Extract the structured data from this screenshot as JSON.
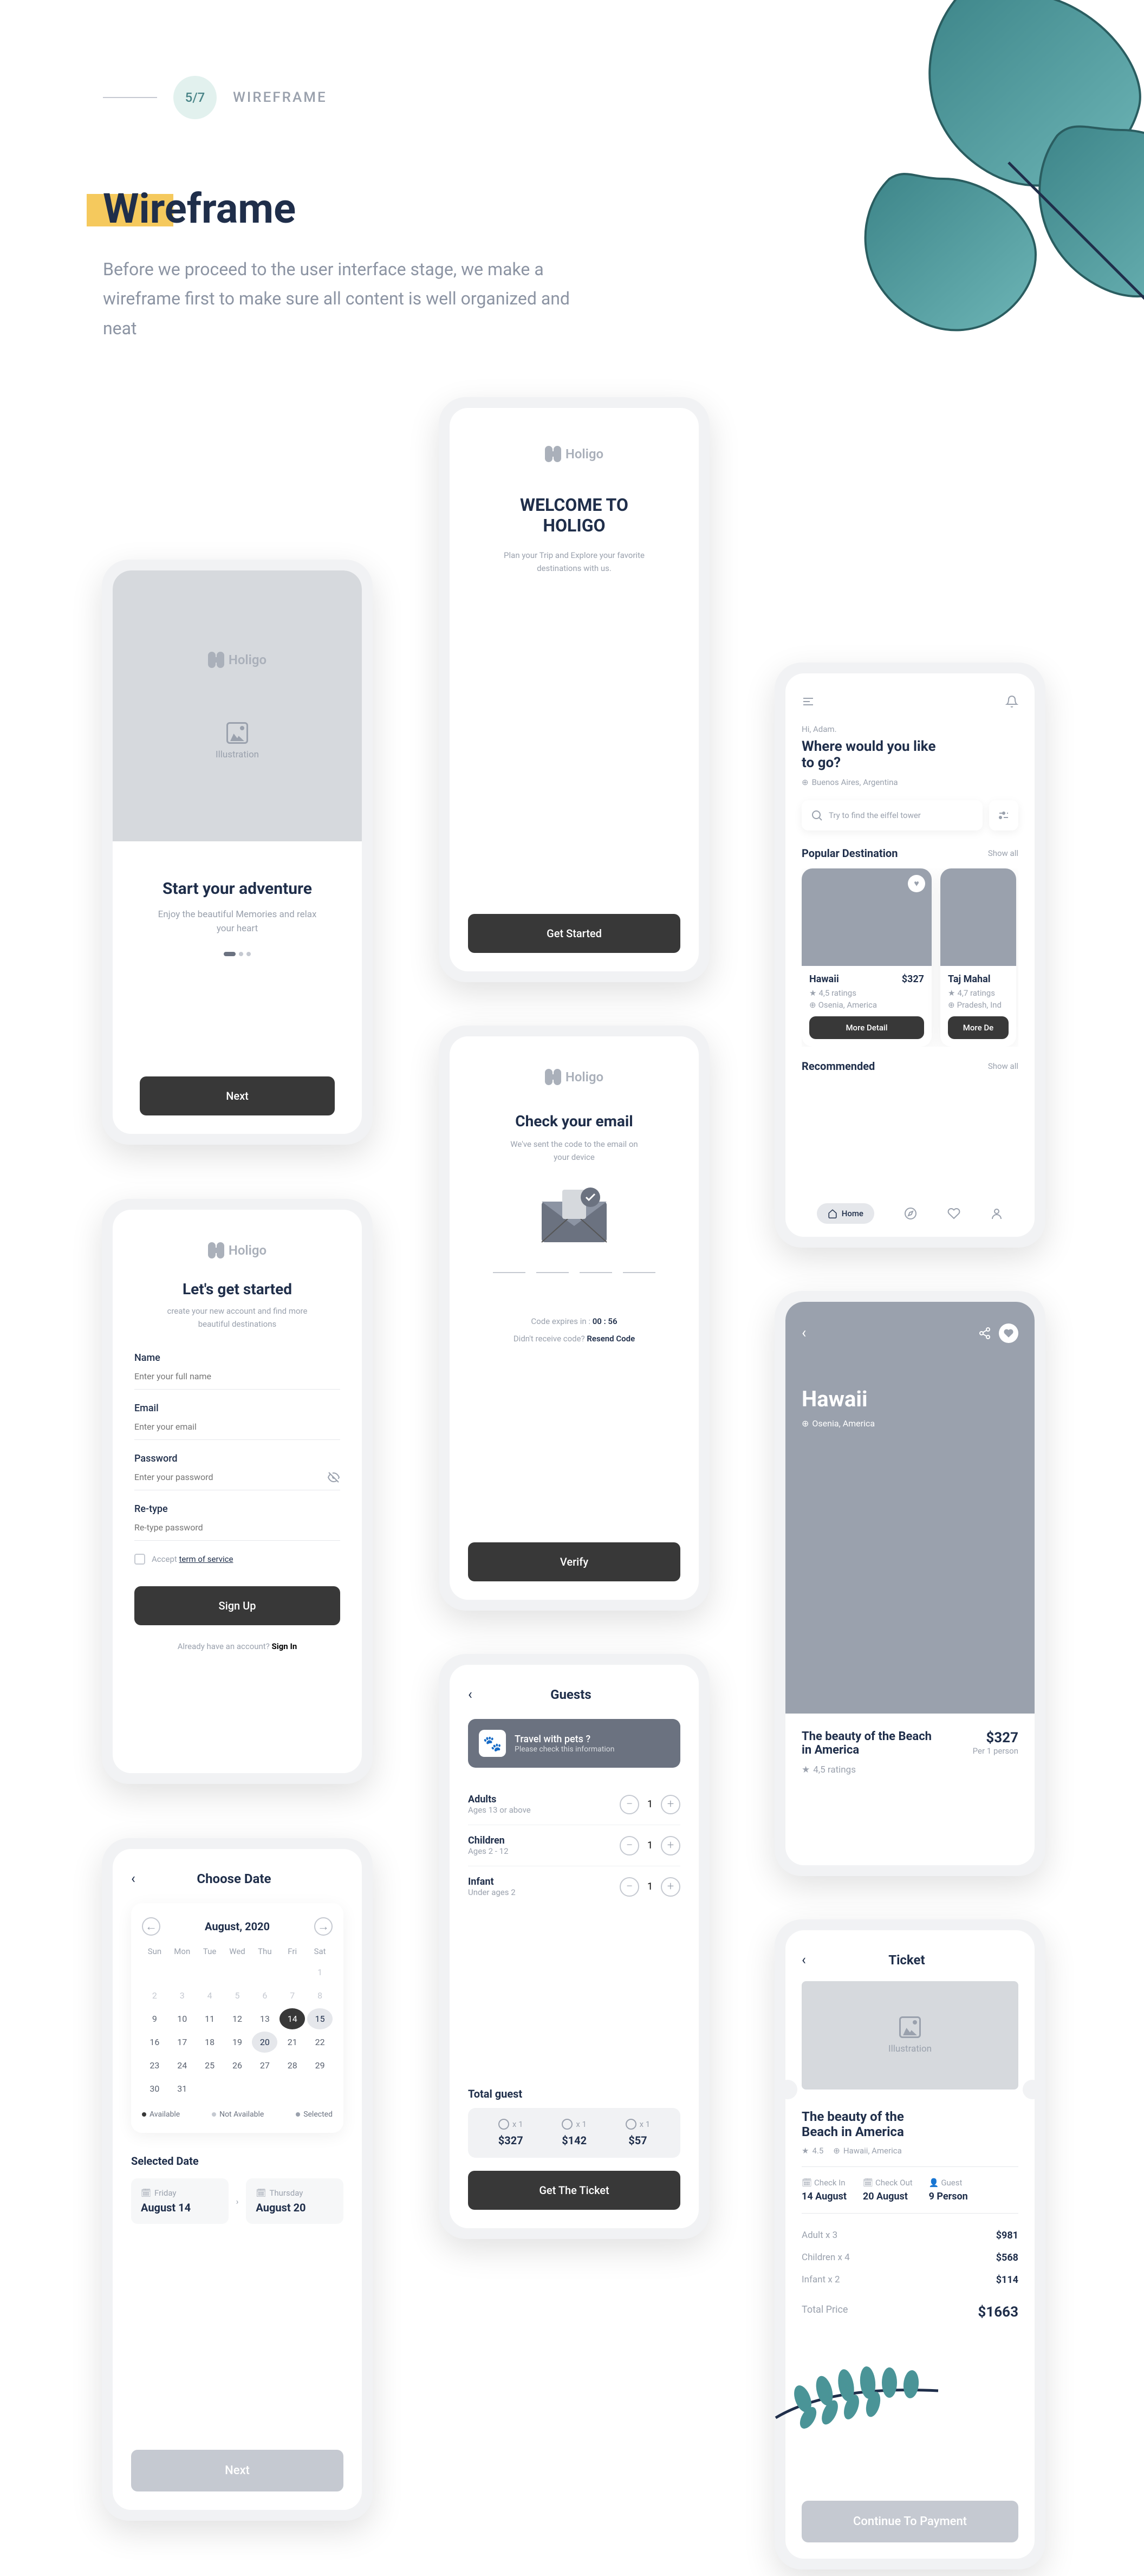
{
  "header": {
    "page": "5/7",
    "label": "WIREFRAME"
  },
  "title": "Wireframe",
  "intro": "Before we proceed to the user interface stage, we make a wireframe first to make sure all content is well organized and neat",
  "brand": "Holigo",
  "onboarding": {
    "illustration": "Illustration",
    "title": "Start your adventure",
    "sub": "Enjoy the beautiful Memories and relax your heart",
    "next": "Next"
  },
  "welcome": {
    "title1": "WELCOME TO",
    "title2": "HOLIGO",
    "sub": "Plan your Trip and Explore your favorite destinations with us.",
    "cta": "Get Started"
  },
  "verify": {
    "title": "Check your email",
    "sub": "We've sent the code to the email on your device",
    "expires_label": "Code expires in :",
    "expires": "00 : 56",
    "resend_q": "Didn't receive code?",
    "resend": "Resend Code",
    "btn": "Verify"
  },
  "signup": {
    "title": "Let's get started",
    "sub": "create your new account and find more beautiful destinations",
    "name": "Name",
    "name_ph": "Enter your full name",
    "email": "Email",
    "email_ph": "Enter your email",
    "password": "Password",
    "password_ph": "Enter your password",
    "retype": "Re-type",
    "retype_ph": "Re-type password",
    "tos_pre": "Accept ",
    "tos_link": "term of service",
    "btn": "Sign Up",
    "login_q": "Already have an account? ",
    "login": "Sign In"
  },
  "guests": {
    "title": "Guests",
    "pets_t": "Travel with pets ?",
    "pets_s": "Please check this information",
    "rows": [
      {
        "name": "Adults",
        "sub": "Ages 13 or above",
        "val": "1"
      },
      {
        "name": "Children",
        "sub": "Ages 2 - 12",
        "val": "1"
      },
      {
        "name": "Infant",
        "sub": "Under ages 2",
        "val": "1"
      }
    ],
    "total": "Total guest",
    "cols": [
      {
        "x": "x 1",
        "p": "$327"
      },
      {
        "x": "x 1",
        "p": "$142"
      },
      {
        "x": "x 1",
        "p": "$57"
      }
    ],
    "btn": "Get The Ticket"
  },
  "date": {
    "title": "Choose Date",
    "month": "August, 2020",
    "days": [
      "Sun",
      "Mon",
      "Tue",
      "Wed",
      "Thu",
      "Fri",
      "Sat"
    ],
    "grid": [
      [
        "",
        "",
        "",
        "",
        "",
        "",
        "1"
      ],
      [
        "2",
        "3",
        "4",
        "5",
        "6",
        "7",
        "8"
      ],
      [
        "9",
        "10",
        "11",
        "12",
        "13",
        "14",
        "15"
      ],
      [
        "16",
        "17",
        "18",
        "19",
        "20",
        "21",
        "22"
      ],
      [
        "23",
        "24",
        "25",
        "26",
        "27",
        "28",
        "29"
      ],
      [
        "30",
        "31",
        "",
        "",
        "",
        "",
        ""
      ]
    ],
    "legend": [
      {
        "l": "Available"
      },
      {
        "l": "Not Available"
      },
      {
        "l": "Selected"
      }
    ],
    "selected_label": "Selected Date",
    "in": {
      "day": "Friday",
      "date": "August 14"
    },
    "out": {
      "day": "Thursday",
      "date": "August 20"
    },
    "next": "Next"
  },
  "home": {
    "greet": "Hi, Adam.",
    "q": "Where would you like to go?",
    "loc": "Buenos Aires, Argentina",
    "search_ph": "Try to find the eiffel tower",
    "pop": "Popular Destination",
    "showall": "Show all",
    "cards": [
      {
        "name": "Hawaii",
        "price": "$327",
        "rating": "4,5 ratings",
        "loc": "Osenia, America",
        "btn": "More Detail"
      },
      {
        "name": "Taj Mahal",
        "rating": "4,7 ratings",
        "loc": "Pradesh, Ind",
        "btn": "More De"
      }
    ],
    "rec": "Recommended",
    "tab_home": "Home"
  },
  "detail": {
    "name": "Hawaii",
    "loc": "Osenia, America",
    "title": "The beauty of the Beach in America",
    "price": "$327",
    "per": "Per 1 person",
    "rating": "4,5 ratings"
  },
  "ticket": {
    "title": "Ticket",
    "illustration": "Illustration",
    "name": "The beauty of the Beach in America",
    "rating": "4.5",
    "loc": "Hawaii, America",
    "ci_l": "Check In",
    "ci": "14 August",
    "co_l": "Check Out",
    "co": "20 August",
    "g_l": "Guest",
    "g": "9 Person",
    "rows": [
      {
        "l": "Adult x 3",
        "v": "$981"
      },
      {
        "l": "Children x 4",
        "v": "$568"
      },
      {
        "l": "Infant x 2",
        "v": "$114"
      }
    ],
    "total_l": "Total Price",
    "total": "$1663",
    "btn": "Continue To Payment"
  }
}
